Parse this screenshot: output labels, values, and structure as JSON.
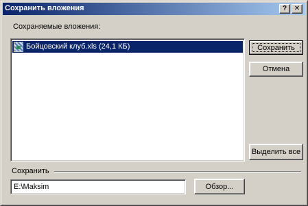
{
  "window": {
    "title": "Сохранить вложения",
    "help_label": "?",
    "close_label": "✕"
  },
  "attachments": {
    "label": "Сохраняемые вложения:",
    "items": [
      {
        "name": "Бойцовский клуб.xls (24,1 КБ)",
        "icon": "excel-file-icon",
        "selected": true
      }
    ]
  },
  "buttons": {
    "save": "Сохранить",
    "cancel": "Отмена",
    "select_all": "Выделить все",
    "browse": "Обзор..."
  },
  "save_to": {
    "label": "Сохранить",
    "path": "E:\\Maksim"
  },
  "colors": {
    "titlebar_start": "#0a246a",
    "titlebar_end": "#a6caf0",
    "selection": "#0a246a",
    "face": "#d4d0c8"
  }
}
